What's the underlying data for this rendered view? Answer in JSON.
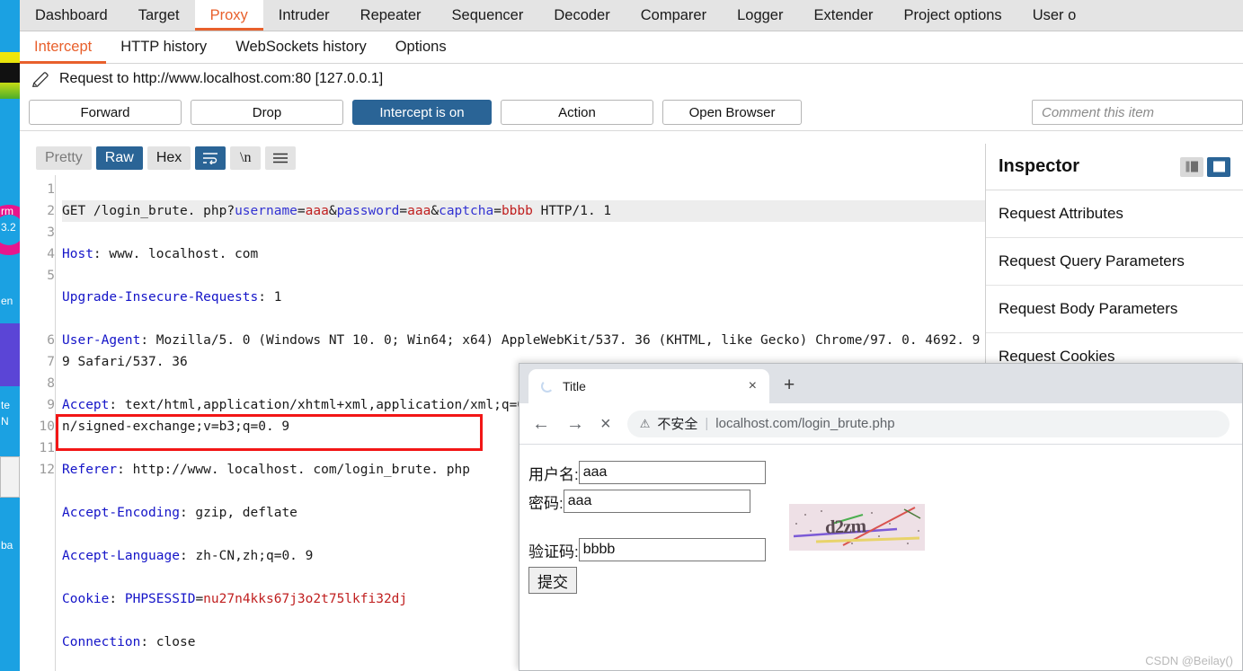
{
  "app": {
    "tabs": [
      {
        "label": "Dashboard",
        "active": false
      },
      {
        "label": "Target",
        "active": false
      },
      {
        "label": "Proxy",
        "active": true
      },
      {
        "label": "Intruder",
        "active": false
      },
      {
        "label": "Repeater",
        "active": false
      },
      {
        "label": "Sequencer",
        "active": false
      },
      {
        "label": "Decoder",
        "active": false
      },
      {
        "label": "Comparer",
        "active": false
      },
      {
        "label": "Logger",
        "active": false
      },
      {
        "label": "Extender",
        "active": false
      },
      {
        "label": "Project options",
        "active": false
      },
      {
        "label": "User o",
        "active": false
      }
    ],
    "subtabs": [
      {
        "label": "Intercept",
        "active": true
      },
      {
        "label": "HTTP history",
        "active": false
      },
      {
        "label": "WebSockets history",
        "active": false
      },
      {
        "label": "Options",
        "active": false
      }
    ]
  },
  "request_header": {
    "title": "Request to http://www.localhost.com:80  [127.0.0.1]"
  },
  "actions": {
    "forward": "Forward",
    "drop": "Drop",
    "intercept": "Intercept is on",
    "action": "Action",
    "open_browser": "Open Browser",
    "comment_placeholder": "Comment this item"
  },
  "viewbar": {
    "pretty": "Pretty",
    "raw": "Raw",
    "hex": "Hex",
    "newline": "\\n"
  },
  "editor": {
    "gutter": [
      "1",
      "2",
      "3",
      "4",
      "5",
      "",
      "",
      "6",
      "7",
      "8",
      "9",
      "10",
      "11",
      "12"
    ],
    "line1": {
      "method_path": "GET /login_brute. php?",
      "p1_key": "username",
      "p1_val": "aaa",
      "amp1": "&",
      "p2_key": "password",
      "p2_val": "aaa",
      "amp2": "&",
      "p3_key": "captcha",
      "p3_val": "bbbb",
      "proto": " HTTP/1. 1"
    },
    "lines": [
      {
        "hdr": "Host",
        "val": " www. localhost. com"
      },
      {
        "hdr": "Upgrade-Insecure-Requests",
        "val": " 1"
      },
      {
        "hdr": "User-Agent",
        "val": " Mozilla/5. 0 (Windows NT 10. 0; Win64; x64) AppleWebKit/537. 36 (KHTML, like Gecko) Chrome/97. 0. 4692. 99 Safari/537. 36"
      },
      {
        "hdr": "Accept",
        "val": " text/html,application/xhtml+xml,application/xml;q=0. 9,image/avif,image/webp,image/apng,*/*;q=0. 8,application/signed-exchange;v=b3;q=0. 9"
      },
      {
        "hdr": "Referer",
        "val": " http://www. localhost. com/login_brute. php"
      },
      {
        "hdr": "Accept-Encoding",
        "val": " gzip, deflate"
      },
      {
        "hdr": "Accept-Language",
        "val": " zh-CN,zh;q=0. 9"
      }
    ],
    "cookie_line": {
      "hdr": "Cookie",
      "key": " PHPSESSID",
      "eq": "=",
      "val": "nu27n4kks67j3o2t75lkfi32dj"
    },
    "last_line": {
      "hdr": "Connection",
      "val": " close"
    }
  },
  "inspector": {
    "title": "Inspector",
    "rows": [
      {
        "label": "Request Attributes"
      },
      {
        "label": "Request Query Parameters"
      },
      {
        "label": "Request Body Parameters"
      },
      {
        "label": "Request Cookies"
      }
    ]
  },
  "browser": {
    "tab_title": "Title",
    "close_label": "×",
    "newtab_label": "+",
    "nav": {
      "back": "←",
      "forward": "→",
      "stop": "×"
    },
    "omnibox": {
      "warn_icon": "⚠",
      "warn_text": "不安全",
      "separator": "|",
      "url": "localhost.com/login_brute.php"
    },
    "page": {
      "username_label": "用户名:",
      "username_value": "aaa",
      "password_label": "密码:",
      "password_value": "aaa",
      "captcha_label": "验证码:",
      "captcha_value": "bbbb",
      "captcha_image_text": "d2zm",
      "submit_label": "提交"
    }
  },
  "watermark": "CSDN @Beilay()",
  "desktop": {
    "labels": [
      "rm",
      "3.2",
      "en",
      "te",
      "N",
      "ba"
    ]
  },
  "colors": {
    "accent_orange": "#e8602c",
    "primary_blue": "#2a6496",
    "annotation_red": "#f21616",
    "header_blue": "#1414c8",
    "value_red": "#c02020"
  }
}
